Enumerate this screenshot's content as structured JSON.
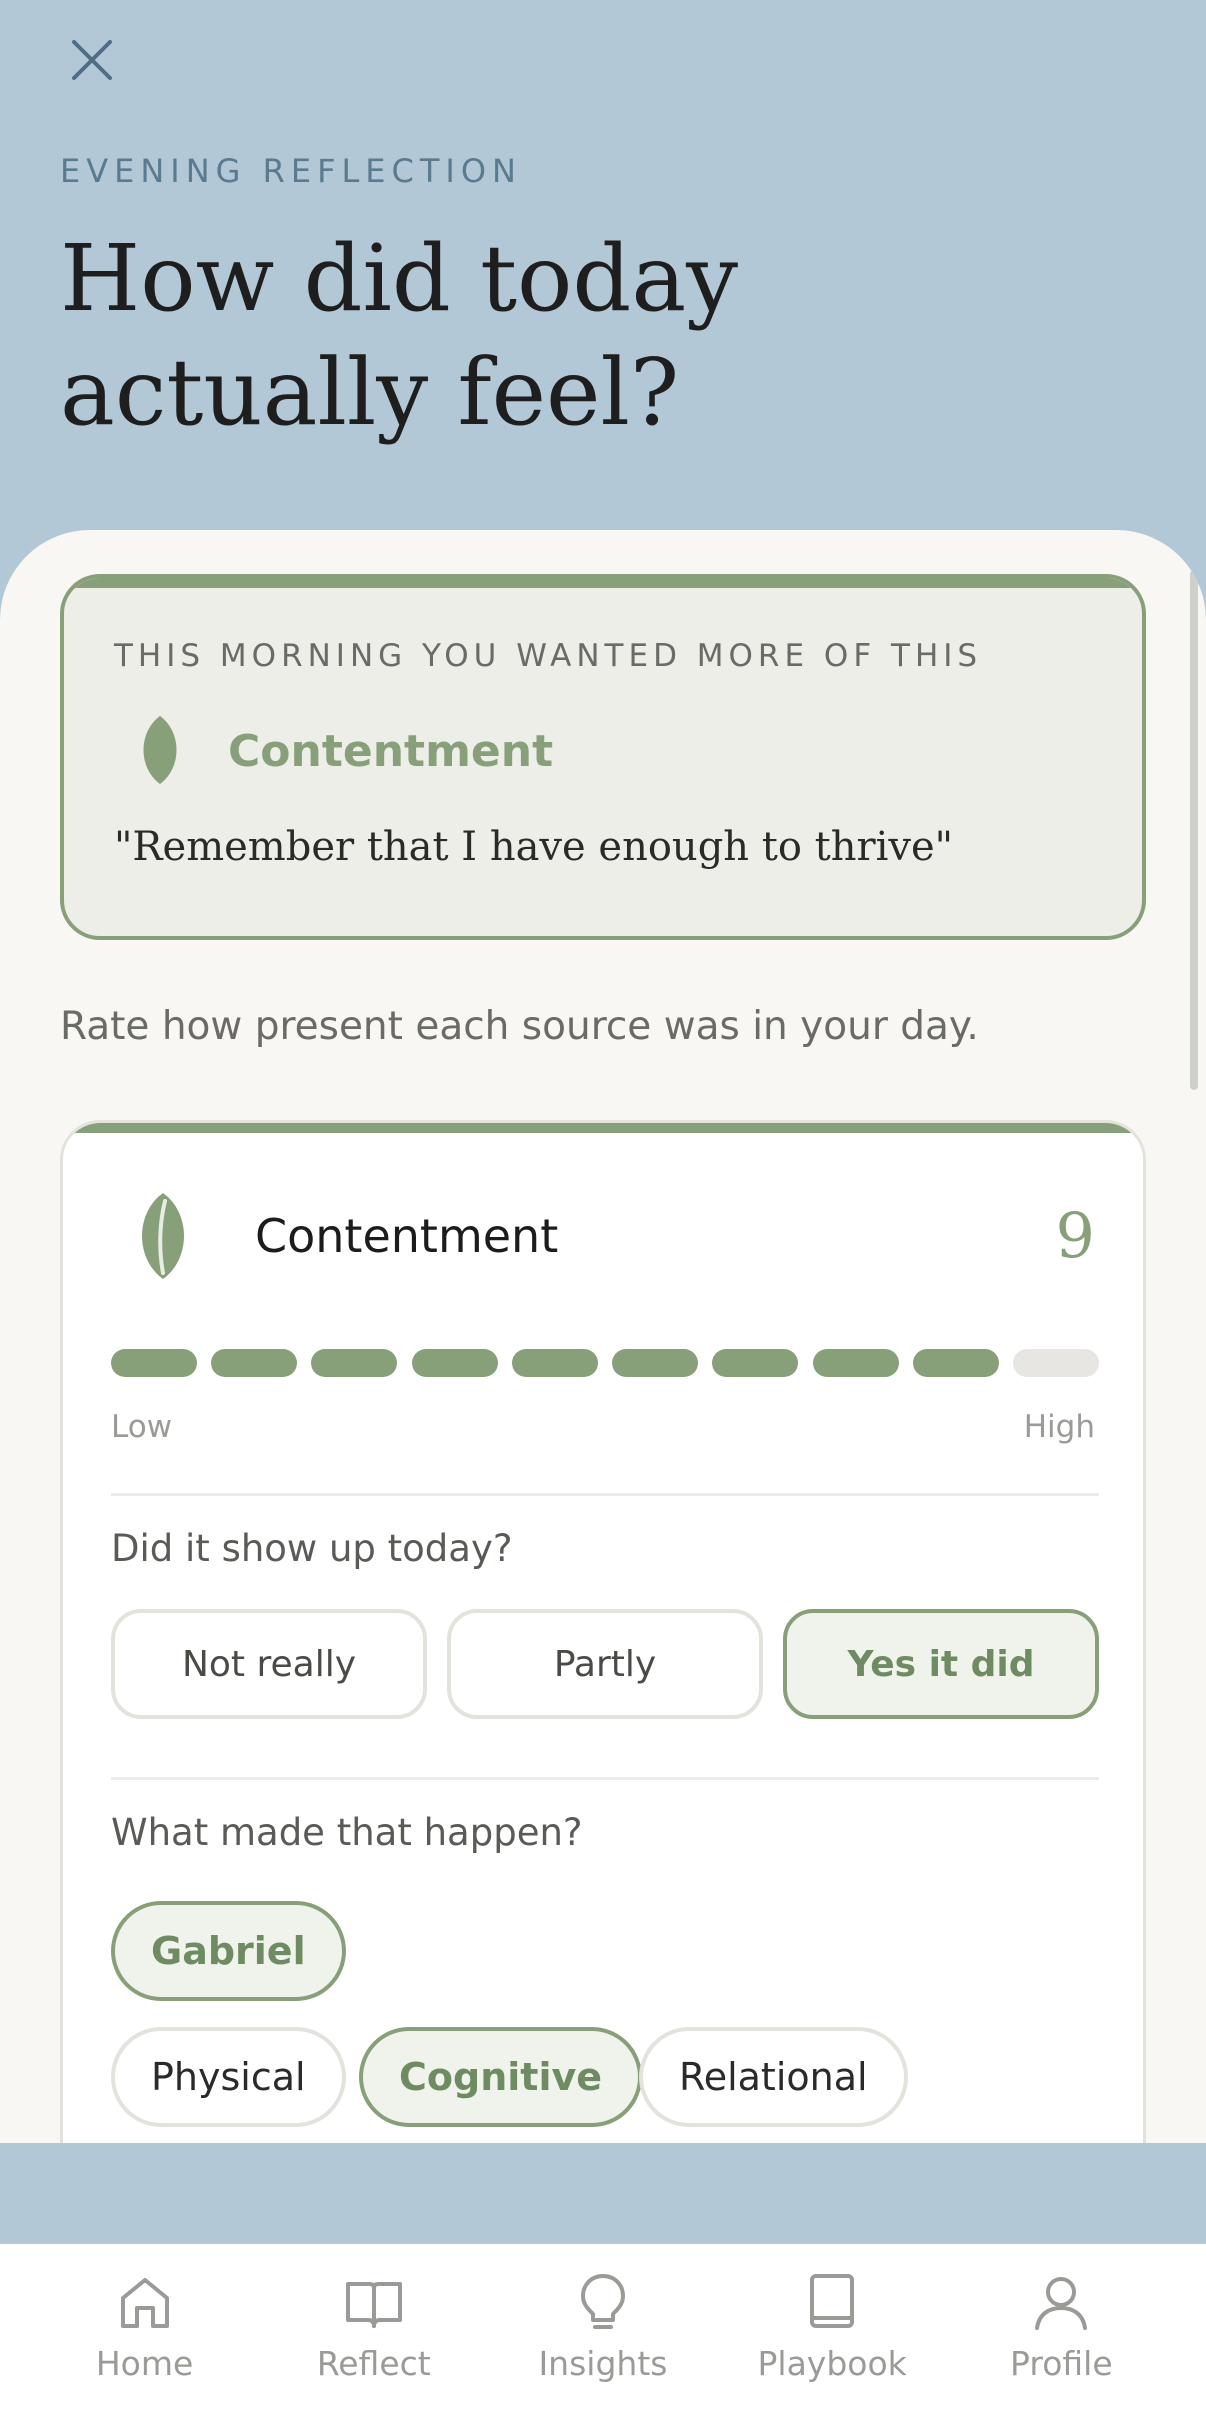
{
  "header": {
    "eyebrow": "EVENING REFLECTION",
    "title": "How did today actually feel?"
  },
  "intention": {
    "label": "THIS MORNING YOU WANTED MORE OF THIS",
    "name": "Contentment",
    "quote": "\"Remember that I have enough to thrive\""
  },
  "instructions": "Rate how present each source was in your day.",
  "rating": {
    "source": "Contentment",
    "score": "9",
    "score_value": 9,
    "max": 10,
    "low_label": "Low",
    "high_label": "High",
    "question1": "Did it show up today?",
    "choices": [
      "Not really",
      "Partly",
      "Yes it did"
    ],
    "selected_choice": "Yes it did",
    "question2": "What made that happen?",
    "chips": [
      "Gabriel",
      "Physical",
      "Cognitive",
      "Relational"
    ],
    "selected_chips": [
      "Gabriel",
      "Cognitive"
    ]
  },
  "tabs": [
    {
      "label": "Home",
      "icon": "home-icon"
    },
    {
      "label": "Reflect",
      "icon": "book-open-icon"
    },
    {
      "label": "Insights",
      "icon": "lightbulb-icon"
    },
    {
      "label": "Playbook",
      "icon": "notebook-icon"
    },
    {
      "label": "Profile",
      "icon": "user-icon"
    }
  ],
  "colors": {
    "background": "#b3c8d6",
    "accent": "#88a07a",
    "sheet": "#f8f7f4"
  }
}
